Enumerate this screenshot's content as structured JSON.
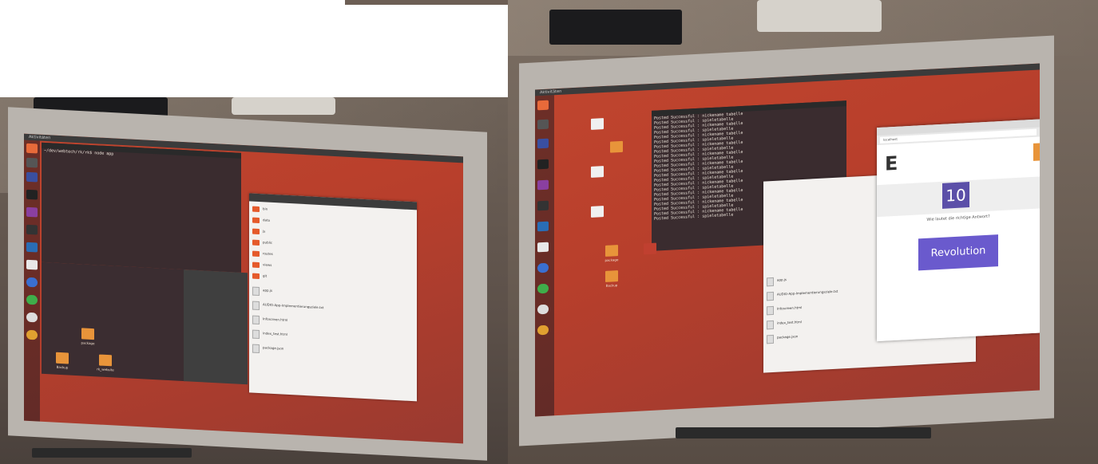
{
  "left_screen": {
    "top_panel_label": "Aktivitäten",
    "terminal": {
      "lines": [
        "~/dev/webtech/rk/rk$ node app"
      ]
    },
    "file_manager": {
      "rows": [
        {
          "name": "bin",
          "kind": "folder"
        },
        {
          "name": "data",
          "kind": "folder"
        },
        {
          "name": "js",
          "kind": "folder"
        },
        {
          "name": "public",
          "kind": "folder"
        },
        {
          "name": "routes",
          "kind": "folder"
        },
        {
          "name": "views",
          "kind": "folder"
        },
        {
          "name": "git",
          "kind": "folder"
        },
        {
          "name": "app.js",
          "kind": "file"
        },
        {
          "name": "AUDIO-App-Implementierungsziele.txt",
          "kind": "file"
        },
        {
          "name": "Infoscreen.html",
          "kind": "file"
        },
        {
          "name": "index_test.html",
          "kind": "file"
        },
        {
          "name": "package.json",
          "kind": "file"
        }
      ]
    },
    "desktop_labels": [
      "package",
      "Backup",
      "rk_website"
    ]
  },
  "right_screen": {
    "top_panel_label": "Aktivitäten",
    "terminal": {
      "lines": [
        "Posted Successful : nickename tabelle",
        "Posted Successful : spieletabelle",
        "Posted Successful : nickename tabelle",
        "Posted Successful : spieletabelle",
        "Posted Successful : nickename tabelle",
        "Posted Successful : spieletabelle",
        "Posted Successful : nickename tabelle",
        "Posted Successful : spieletabelle",
        "Posted Successful : nickename tabelle",
        "Posted Successful : spieletabelle",
        "Posted Successful : nickename tabelle",
        "Posted Successful : spieletabelle",
        "Posted Successful : nickename tabelle",
        "Posted Successful : spieletabelle",
        "Posted Successful : nickename tabelle",
        "Posted Successful : spieletabelle",
        "Posted Successful : nickename tabelle",
        "Posted Successful : spieletabelle",
        "Posted Successful : nickename tabelle",
        "Posted Successful : spieletabelle",
        "Posted Successful : nickename tabelle",
        "Posted Successful : spieletabelle"
      ]
    },
    "file_list": [
      "app.js",
      "AUDIO-App-Implementierungsziele.txt",
      "Infoscreen.html",
      "index_test.html",
      "package.json"
    ],
    "browser": {
      "address": "localhost",
      "counter": "10",
      "question": "Wie lautet die richtige Antwort?",
      "answer_button": "Revolution"
    },
    "desktop_labels": [
      "Backup",
      "package"
    ]
  },
  "colors": {
    "ubuntu_wallpaper": "#c0452e",
    "terminal_bg": "#3a2c2f",
    "answer_button": "#6a5acd",
    "counter_box": "#5b4fa8"
  }
}
